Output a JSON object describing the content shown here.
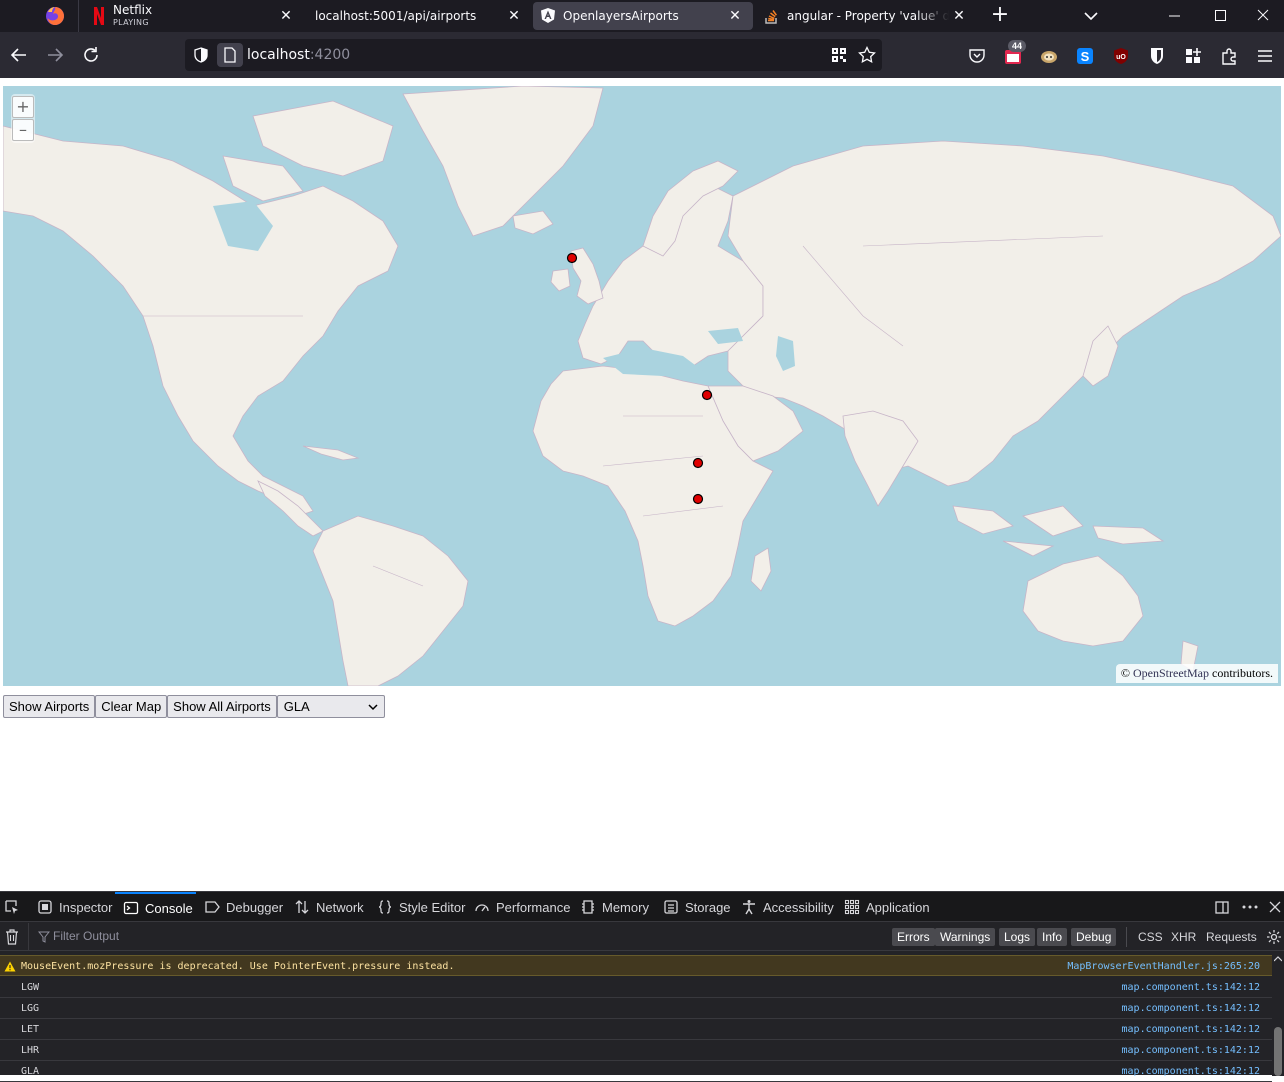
{
  "browser": {
    "tabs": [
      {
        "title": "Netflix",
        "subtitle": "PLAYING"
      },
      {
        "title": "localhost:5001/api/airports"
      },
      {
        "title": "OpenlayersAirports"
      },
      {
        "title": "angular - Property 'value' does not exist"
      }
    ],
    "url_host": "localhost",
    "url_port": ":4200",
    "extension_badge": "44"
  },
  "map": {
    "zoom_in_label": "+",
    "zoom_out_label": "–",
    "attribution_prefix": "© ",
    "attribution_link": "OpenStreetMap",
    "attribution_suffix": " contributors."
  },
  "controls": {
    "show_airports_label": "Show Airports",
    "clear_map_label": "Clear Map",
    "show_all_label": "Show All Airports",
    "airport_select_value": "GLA"
  },
  "devtools": {
    "tabs": [
      "Inspector",
      "Console",
      "Debugger",
      "Network",
      "Style Editor",
      "Performance",
      "Memory",
      "Storage",
      "Accessibility",
      "Application"
    ],
    "active_tab": "Console",
    "filter_placeholder": "Filter Output",
    "levels": [
      "Errors",
      "Warnings",
      "Logs",
      "Info",
      "Debug"
    ],
    "net_filters": [
      "CSS",
      "XHR",
      "Requests"
    ],
    "messages": [
      {
        "type": "warn",
        "text": "MouseEvent.mozPressure is deprecated. Use PointerEvent.pressure instead.",
        "source": "MapBrowserEventHandler.js:265:20"
      },
      {
        "type": "log",
        "text": "LGW",
        "source": "map.component.ts:142:12"
      },
      {
        "type": "log",
        "text": "LGG",
        "source": "map.component.ts:142:12"
      },
      {
        "type": "log",
        "text": "LET",
        "source": "map.component.ts:142:12"
      },
      {
        "type": "log",
        "text": "LHR",
        "source": "map.component.ts:142:12"
      },
      {
        "type": "log",
        "text": "GLA",
        "source": "map.component.ts:142:12"
      }
    ]
  }
}
